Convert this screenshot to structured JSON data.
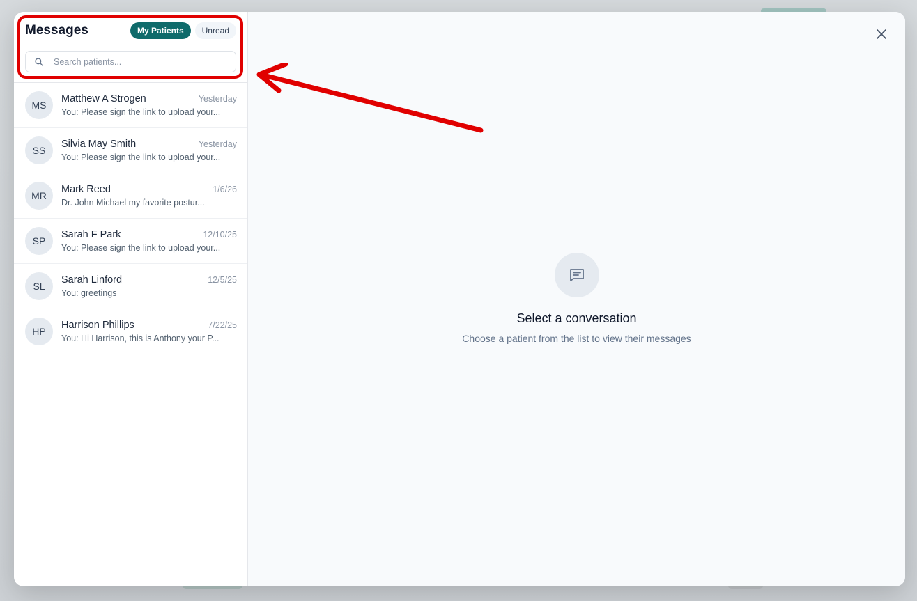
{
  "sidebar": {
    "title": "Messages",
    "filters": [
      {
        "label": "My Patients",
        "active": true
      },
      {
        "label": "Unread",
        "active": false
      }
    ],
    "search": {
      "placeholder": "Search patients...",
      "value": ""
    },
    "conversations": [
      {
        "initials": "MS",
        "name": "Matthew A Strogen",
        "date": "Yesterday",
        "preview": "You: Please sign the link to upload your..."
      },
      {
        "initials": "SS",
        "name": "Silvia May Smith",
        "date": "Yesterday",
        "preview": "You: Please sign the link to upload your..."
      },
      {
        "initials": "MR",
        "name": "Mark Reed",
        "date": "1/6/26",
        "preview": "Dr. John Michael my favorite postur..."
      },
      {
        "initials": "SP",
        "name": "Sarah F Park",
        "date": "12/10/25",
        "preview": "You: Please sign the link to upload your..."
      },
      {
        "initials": "SL",
        "name": "Sarah Linford",
        "date": "12/5/25",
        "preview": "You: greetings"
      },
      {
        "initials": "HP",
        "name": "Harrison Phillips",
        "date": "7/22/25",
        "preview": "You: Hi Harrison, this is Anthony your P..."
      }
    ]
  },
  "main": {
    "empty_title": "Select a conversation",
    "empty_subtitle": "Choose a patient from the list to view their messages"
  },
  "icons": {
    "search": "search-icon",
    "close": "close-icon",
    "empty": "message-square-icon"
  },
  "colors": {
    "accent": "#0f6b6b",
    "annotation": "#e00000"
  }
}
